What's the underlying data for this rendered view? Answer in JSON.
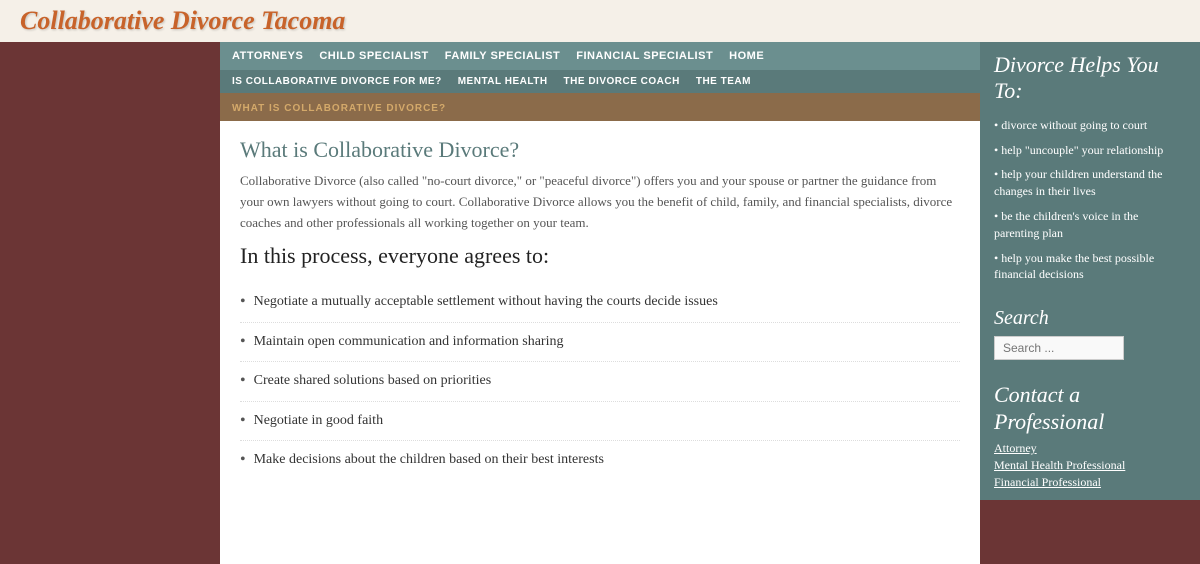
{
  "site": {
    "title": "Collaborative Divorce Tacoma"
  },
  "nav_primary": {
    "items": [
      {
        "label": "ATTORNEYS",
        "href": "#"
      },
      {
        "label": "CHILD SPECIALIST",
        "href": "#"
      },
      {
        "label": "FAMILY SPECIALIST",
        "href": "#"
      },
      {
        "label": "FINANCIAL SPECIALIST",
        "href": "#"
      },
      {
        "label": "HOME",
        "href": "#"
      }
    ]
  },
  "nav_secondary": {
    "items": [
      {
        "label": "IS COLLABORATIVE DIVORCE FOR ME?",
        "href": "#"
      },
      {
        "label": "MENTAL HEALTH",
        "href": "#"
      },
      {
        "label": "THE DIVORCE COACH",
        "href": "#"
      },
      {
        "label": "THE TEAM",
        "href": "#"
      }
    ]
  },
  "nav_current": {
    "label": "WHAT IS COLLABORATIVE DIVORCE?"
  },
  "main": {
    "page_title": "What is Collaborative Divorce?",
    "intro_paragraph": "Collaborative Divorce (also called \"no-court divorce,\" or \"peaceful divorce\") offers you and your spouse or partner the guidance from your own lawyers without going to court.  Collaborative Divorce allows you the benefit of child, family, and financial specialists, divorce coaches and other professionals all working together on your team.",
    "process_heading": "In this process, everyone agrees to:",
    "bullets": [
      "Negotiate a mutually acceptable settlement without having the courts decide issues",
      "Maintain open communication and information sharing",
      "Create shared solutions based on priorities",
      "Negotiate in good faith",
      "Make decisions about the children based on their best interests"
    ]
  },
  "sidebar": {
    "divorce_helps_title": "Divorce Helps You To:",
    "divorce_helps_bullets": [
      "divorce without going to court",
      "help \"uncouple\" your relationship",
      "help your children understand the changes in their lives",
      "be the children's voice in the parenting plan",
      "help you make the best possible financial decisions"
    ],
    "search_title": "Search",
    "search_placeholder": "Search ...",
    "contact_title": "Contact a Professional",
    "contact_links": [
      {
        "label": "Attorney",
        "href": "#"
      },
      {
        "label": "Mental Health Professional",
        "href": "#"
      },
      {
        "label": "Financial Professional",
        "href": "#"
      }
    ]
  },
  "bg_decorative": {
    "title": "Divorce Helps You To:",
    "items": [
      "divorce without going to court",
      "help \"uncouple\" your relationship"
    ]
  }
}
